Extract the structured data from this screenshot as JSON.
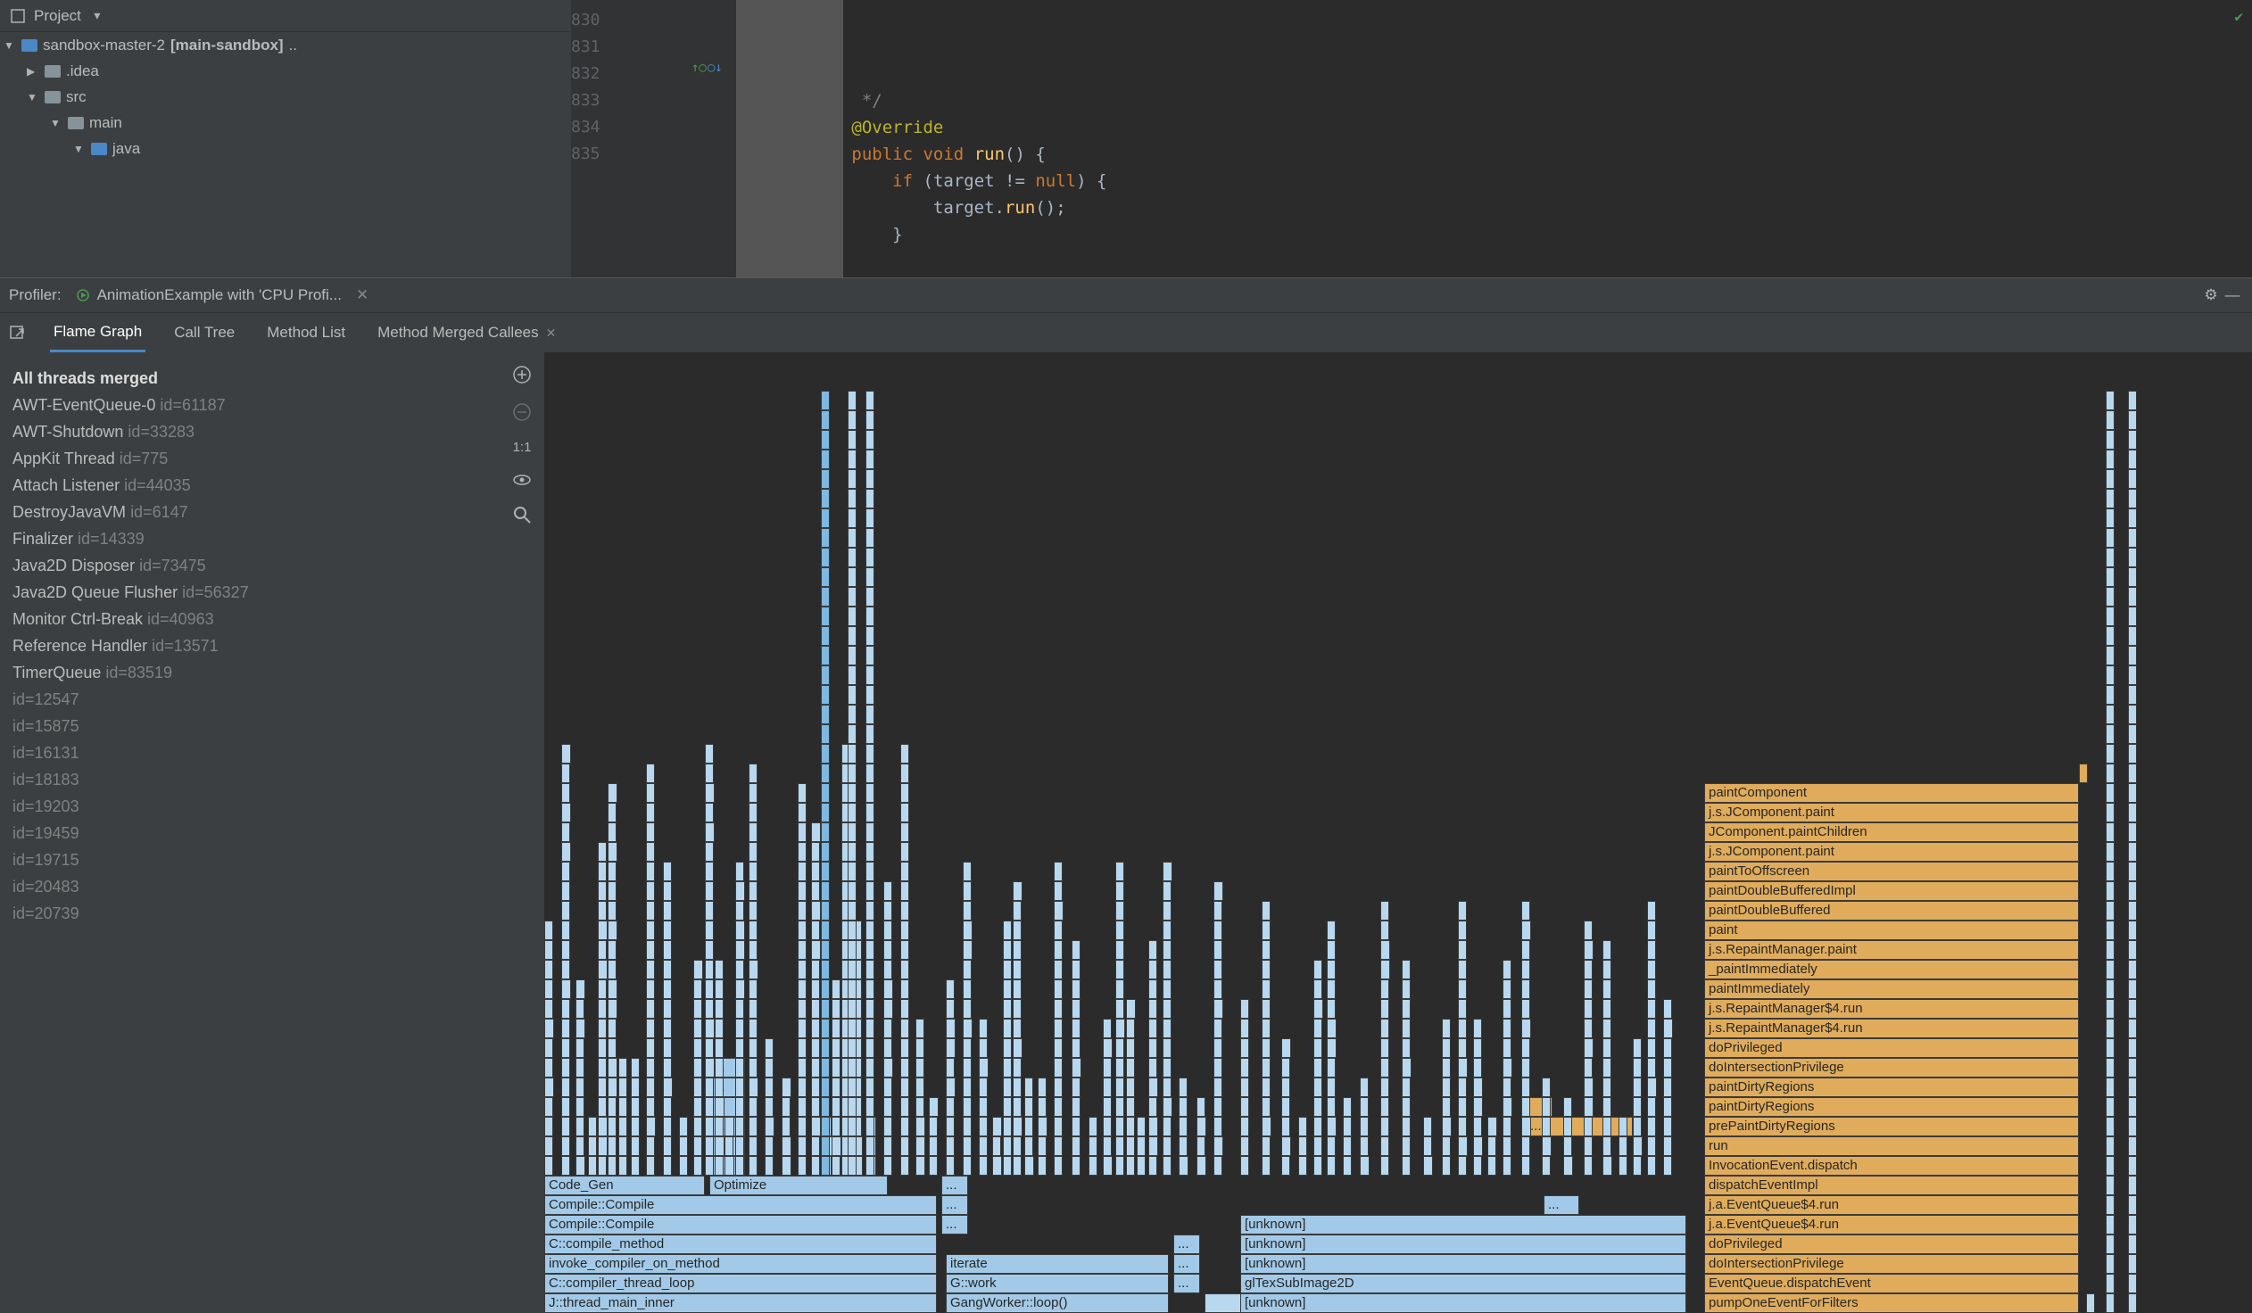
{
  "header": {
    "title": "Project"
  },
  "tree": {
    "root_name": "sandbox-master-2",
    "root_extra": "[main-sandbox]",
    "items": [
      {
        "indent": 1,
        "arrow": "▶",
        "name": ".idea"
      },
      {
        "indent": 1,
        "arrow": "▼",
        "name": "src"
      },
      {
        "indent": 2,
        "arrow": "▼",
        "name": "main"
      },
      {
        "indent": 3,
        "arrow": "▼",
        "name": "java",
        "blue": true
      }
    ]
  },
  "editor": {
    "lines": [
      {
        "num": "830",
        "html": "           <span class='grey'>*/</span>"
      },
      {
        "num": "831",
        "html": "          <span class='annotation'>@Override</span>"
      },
      {
        "num": "832",
        "html": "          <span class='keyword'>public</span> <span class='keyword'>void</span> <span class='method'>run</span><span class='plain'>() {</span>"
      },
      {
        "num": "833",
        "html": "              <span class='keyword'>if</span> <span class='plain'>(target != </span><span class='keyword'>null</span><span class='plain'>) {</span>"
      },
      {
        "num": "834",
        "html": "                  <span class='plain'>target.</span><span class='method'>run</span><span class='plain'>();</span>"
      },
      {
        "num": "835",
        "html": "              <span class='plain'>}</span>"
      }
    ]
  },
  "profiler": {
    "label": "Profiler:",
    "tab_title": "AnimationExample with 'CPU Profi...",
    "subtabs": [
      "Flame Graph",
      "Call Tree",
      "Method List",
      "Method Merged Callees"
    ]
  },
  "threads": {
    "merged": "All threads merged",
    "list": [
      {
        "name": "AWT-EventQueue-0",
        "id": "id=61187"
      },
      {
        "name": "AWT-Shutdown",
        "id": "id=33283"
      },
      {
        "name": "AppKit Thread",
        "id": "id=775"
      },
      {
        "name": "Attach Listener",
        "id": "id=44035"
      },
      {
        "name": "DestroyJavaVM",
        "id": "id=6147"
      },
      {
        "name": "Finalizer",
        "id": "id=14339"
      },
      {
        "name": "Java2D Disposer",
        "id": "id=73475"
      },
      {
        "name": "Java2D Queue Flusher",
        "id": "id=56327"
      },
      {
        "name": "Monitor Ctrl-Break",
        "id": "id=40963"
      },
      {
        "name": "Reference Handler",
        "id": "id=13571"
      },
      {
        "name": "TimerQueue",
        "id": "id=83519"
      },
      {
        "name": "",
        "id": "id=12547"
      },
      {
        "name": "",
        "id": "id=15875"
      },
      {
        "name": "",
        "id": "id=16131"
      },
      {
        "name": "",
        "id": "id=18183"
      },
      {
        "name": "",
        "id": "id=19203"
      },
      {
        "name": "",
        "id": "id=19459"
      },
      {
        "name": "",
        "id": "id=19715"
      },
      {
        "name": "",
        "id": "id=20483"
      },
      {
        "name": "",
        "id": "id=20739"
      }
    ]
  },
  "flame": {
    "yellow_stack": [
      "paintComponent",
      "j.s.JComponent.paint",
      "JComponent.paintChildren",
      "j.s.JComponent.paint",
      "paintToOffscreen",
      "paintDoubleBufferedImpl",
      "paintDoubleBuffered",
      "paint",
      "j.s.RepaintManager.paint",
      "_paintImmediately",
      "paintImmediately",
      "j.s.RepaintManager$4.run",
      "j.s.RepaintManager$4.run",
      "doPrivileged",
      "doIntersectionPrivilege",
      "paintDirtyRegions",
      "paintDirtyRegions",
      "prePaintDirtyRegions",
      "run",
      "InvocationEvent.dispatch",
      "dispatchEventImpl",
      "j.a.EventQueue$4.run",
      "j.a.EventQueue$4.run",
      "doPrivileged",
      "doIntersectionPrivilege",
      "EventQueue.dispatchEvent",
      "pumpOneEventForFilters"
    ],
    "left_stack_bottom": [
      "J::thread_main_inner",
      "C::compiler_thread_loop",
      "invoke_compiler_on_method",
      "C::compile_method",
      "Compile::Compile",
      "Compile::Compile"
    ],
    "left_code_gen": "Code_Gen",
    "left_optimize": "Optimize",
    "middle_stack": [
      "GangWorker::loop()",
      "G::work",
      "iterate"
    ],
    "gl_stack": [
      "[unknown]",
      "glTexSubImage2D",
      "[unknown]",
      "[unknown]",
      "[unknown]"
    ],
    "ellipsis": "...",
    "unknown": "[unknown]"
  },
  "flame_tools": {
    "zoom_fit": "1:1"
  }
}
